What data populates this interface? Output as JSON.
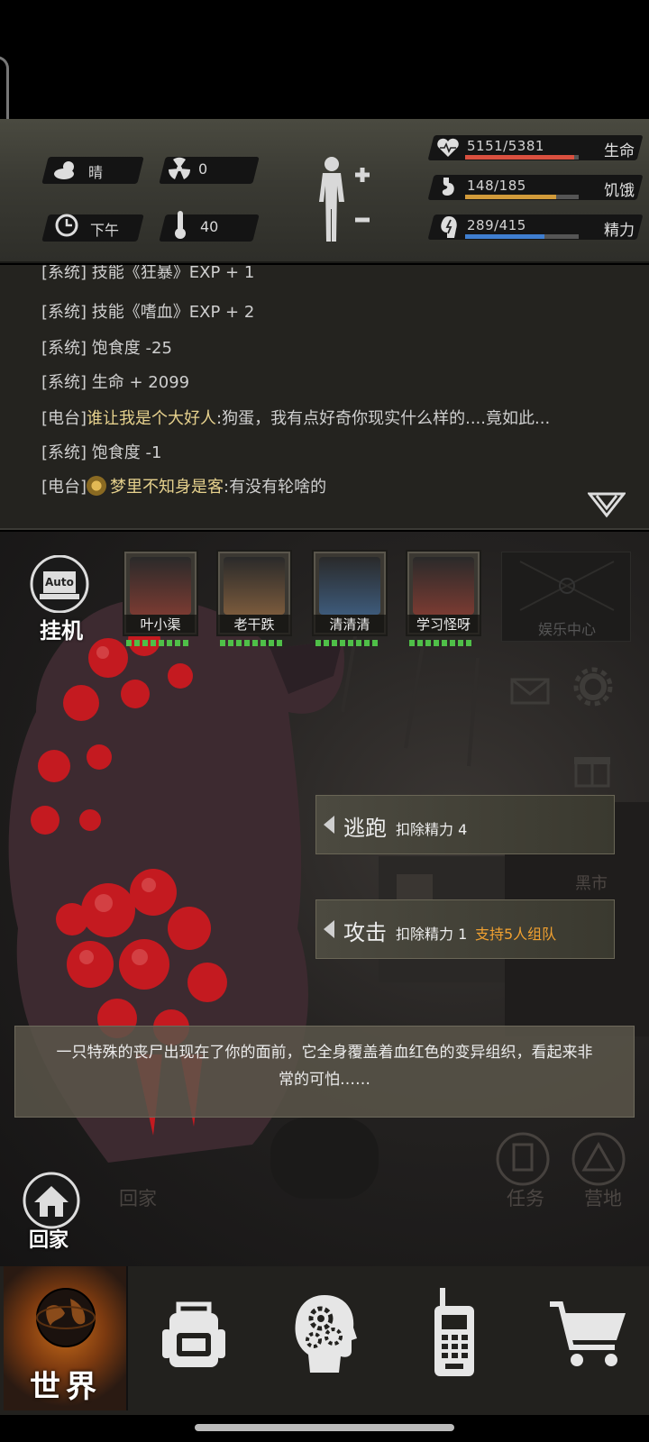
{
  "weather": {
    "condition": "晴",
    "radiation": "0",
    "time_of_day": "下午",
    "temperature": "40"
  },
  "stats": [
    {
      "label": "生命",
      "value": "5151/5381",
      "current": 5151,
      "max": 5381,
      "color": "#d9503f"
    },
    {
      "label": "饥饿",
      "value": "148/185",
      "current": 148,
      "max": 185,
      "color": "#d19a3a"
    },
    {
      "label": "精力",
      "value": "289/415",
      "current": 289,
      "max": 415,
      "color": "#3f7ed0"
    }
  ],
  "log": [
    {
      "tag": "[系统]",
      "text": "技能《狂暴》EXP + 1",
      "kind": "system"
    },
    {
      "tag": "[系统]",
      "text": "技能《嗜血》EXP + 2",
      "kind": "system"
    },
    {
      "tag": "[系统]",
      "text": "饱食度 -25",
      "kind": "system"
    },
    {
      "tag": "[系统]",
      "text": "生命 + 2099",
      "kind": "system"
    },
    {
      "tag": "[电台]",
      "speaker": "谁让我是个大好人",
      "text": ":狗蛋，我有点好奇你现实什么样的....竟如此...",
      "kind": "radio"
    },
    {
      "tag": "[系统]",
      "text": "饱食度 -1",
      "kind": "system"
    },
    {
      "tag": "[电台]",
      "speaker": "梦里不知身是客",
      "text": ":有没有轮啥的",
      "kind": "radio"
    }
  ],
  "auto": {
    "badge": "Auto",
    "label": "挂机"
  },
  "team": [
    {
      "name": "叶小渠",
      "face_color": "#7a3b32"
    },
    {
      "name": "老干跌",
      "face_color": "#7a5a3c"
    },
    {
      "name": "清清清",
      "face_color": "#3d5a7a"
    },
    {
      "name": "学习怪呀",
      "face_color": "#7a3b32"
    }
  ],
  "entertainment": {
    "label": "娱乐中心"
  },
  "side_labels": {
    "black_market": "黑市"
  },
  "actions": [
    {
      "label": "逃跑",
      "cost": "扣除精力 4",
      "extra": ""
    },
    {
      "label": "攻击",
      "cost": "扣除精力 1",
      "extra": "支持5人组队"
    }
  ],
  "narration": "一只特殊的丧尸出现在了你的面前，它全身覆盖着血红色的变异组织，看起来非常的可怕……",
  "home_button": {
    "label": "回家"
  },
  "ghost_buttons": {
    "home": "回家",
    "task": "任务",
    "camp": "营地"
  },
  "nav": [
    {
      "label": "世界",
      "icon": "globe-icon",
      "active": true
    },
    {
      "label": "",
      "icon": "backpack-icon",
      "active": false
    },
    {
      "label": "",
      "icon": "head-gears-icon",
      "active": false
    },
    {
      "label": "",
      "icon": "walkie-talkie-icon",
      "active": false
    },
    {
      "label": "",
      "icon": "cart-icon",
      "active": false
    }
  ]
}
